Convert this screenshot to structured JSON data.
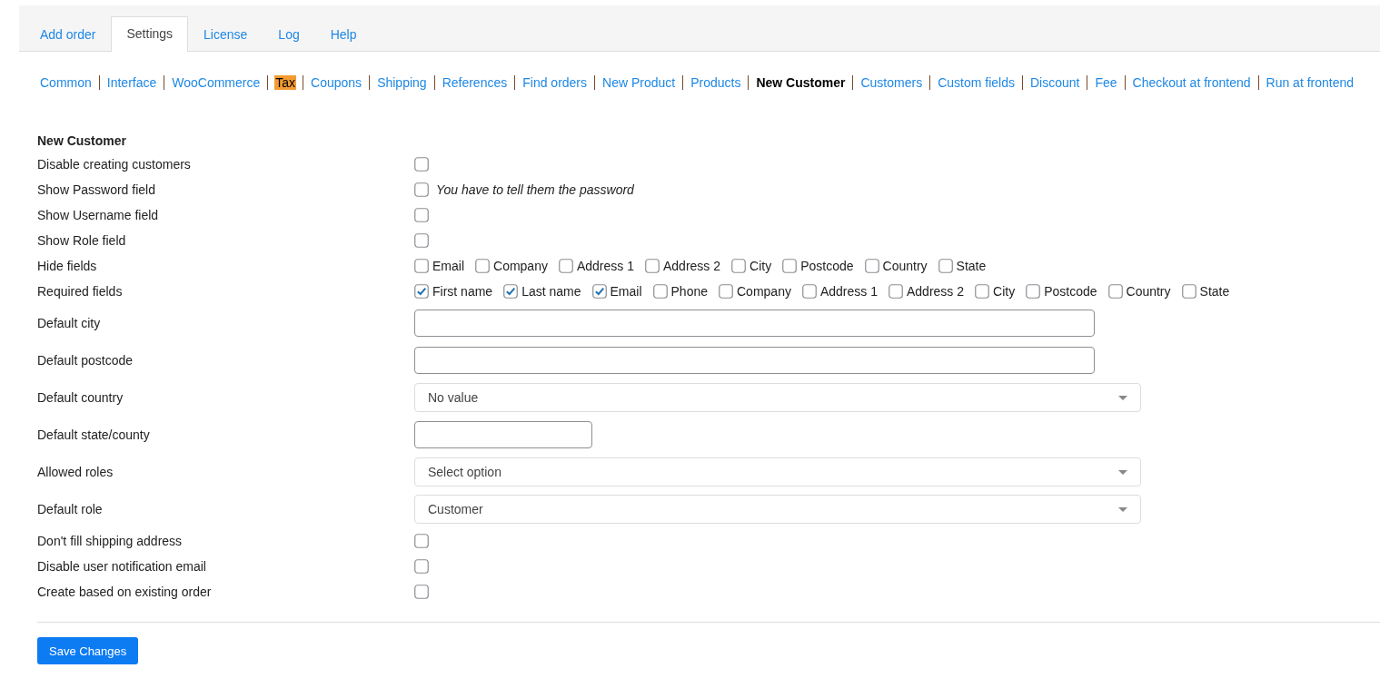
{
  "tabs": [
    {
      "label": "Add order",
      "selected": false
    },
    {
      "label": "Settings",
      "selected": true
    },
    {
      "label": "License",
      "selected": false
    },
    {
      "label": "Log",
      "selected": false
    },
    {
      "label": "Help",
      "selected": false
    }
  ],
  "subnav": [
    {
      "label": "Common",
      "selected": false,
      "highlighted": false
    },
    {
      "label": "Interface",
      "selected": false,
      "highlighted": false
    },
    {
      "label": "WooCommerce",
      "selected": false,
      "highlighted": false
    },
    {
      "label": "Tax",
      "selected": false,
      "highlighted": true
    },
    {
      "label": "Coupons",
      "selected": false,
      "highlighted": false
    },
    {
      "label": "Shipping",
      "selected": false,
      "highlighted": false
    },
    {
      "label": "References",
      "selected": false,
      "highlighted": false
    },
    {
      "label": "Find orders",
      "selected": false,
      "highlighted": false
    },
    {
      "label": "New Product",
      "selected": false,
      "highlighted": false
    },
    {
      "label": "Products",
      "selected": false,
      "highlighted": false
    },
    {
      "label": "New Customer",
      "selected": true,
      "highlighted": false
    },
    {
      "label": "Customers",
      "selected": false,
      "highlighted": false
    },
    {
      "label": "Custom fields",
      "selected": false,
      "highlighted": false
    },
    {
      "label": "Discount",
      "selected": false,
      "highlighted": false
    },
    {
      "label": "Fee",
      "selected": false,
      "highlighted": false
    },
    {
      "label": "Checkout at frontend",
      "selected": false,
      "highlighted": false
    },
    {
      "label": "Run at frontend",
      "selected": false,
      "highlighted": false
    }
  ],
  "section_title": "New Customer",
  "settings": [
    {
      "kind": "checkbox",
      "label": "Disable creating customers",
      "checked": false
    },
    {
      "kind": "checkbox",
      "label": "Show Password field",
      "checked": false,
      "note": "You have to tell them the password"
    },
    {
      "kind": "checkbox",
      "label": "Show Username field",
      "checked": false
    },
    {
      "kind": "checkbox",
      "label": "Show Role field",
      "checked": false
    },
    {
      "kind": "group",
      "label": "Hide fields",
      "options": [
        {
          "label": "Email",
          "checked": false
        },
        {
          "label": "Company",
          "checked": false
        },
        {
          "label": "Address 1",
          "checked": false
        },
        {
          "label": "Address 2",
          "checked": false
        },
        {
          "label": "City",
          "checked": false
        },
        {
          "label": "Postcode",
          "checked": false
        },
        {
          "label": "Country",
          "checked": false
        },
        {
          "label": "State",
          "checked": false
        }
      ]
    },
    {
      "kind": "group",
      "label": "Required fields",
      "options": [
        {
          "label": "First name",
          "checked": true
        },
        {
          "label": "Last name",
          "checked": true
        },
        {
          "label": "Email",
          "checked": true
        },
        {
          "label": "Phone",
          "checked": false
        },
        {
          "label": "Company",
          "checked": false
        },
        {
          "label": "Address 1",
          "checked": false
        },
        {
          "label": "Address 2",
          "checked": false
        },
        {
          "label": "City",
          "checked": false
        },
        {
          "label": "Postcode",
          "checked": false
        },
        {
          "label": "Country",
          "checked": false
        },
        {
          "label": "State",
          "checked": false
        }
      ]
    },
    {
      "kind": "text",
      "label": "Default city"
    },
    {
      "kind": "text",
      "label": "Default postcode"
    },
    {
      "kind": "select",
      "label": "Default country",
      "value": "No value"
    },
    {
      "kind": "short-text",
      "label": "Default state/county"
    },
    {
      "kind": "select",
      "label": "Allowed roles",
      "placeholder": "Select option"
    },
    {
      "kind": "select",
      "label": "Default role",
      "value": "Customer"
    },
    {
      "kind": "checkbox",
      "label": "Don't fill shipping address",
      "checked": false
    },
    {
      "kind": "checkbox",
      "label": "Disable user notification email",
      "checked": false
    },
    {
      "kind": "checkbox",
      "label": "Create based on existing order",
      "checked": false
    }
  ],
  "save_button": "Save Changes"
}
